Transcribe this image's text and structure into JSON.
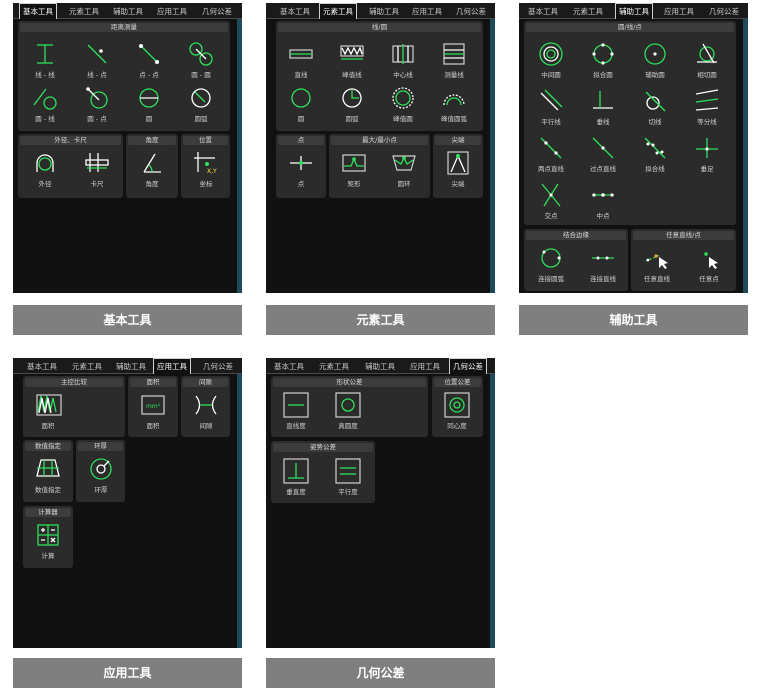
{
  "tabs": [
    "基本工具",
    "元素工具",
    "辅助工具",
    "应用工具",
    "几何公差"
  ],
  "captions": {
    "basic": "基本工具",
    "element": "元素工具",
    "aux": "辅助工具",
    "app": "应用工具",
    "geo": "几何公差"
  },
  "basic": {
    "dist_title": "距离测量",
    "dist_items": [
      "线 - 线",
      "线 - 点",
      "点 - 点",
      "圆 - 圆",
      "圆 - 线",
      "圆 - 点",
      "圆",
      "圆弧"
    ],
    "outer_title": "外径、卡尺",
    "outer_items": [
      "外径",
      "卡尺"
    ],
    "angle_title": "角度",
    "angle_item": "角度",
    "pos_title": "位置",
    "pos_item": "坐标",
    "xy_text": "X,Y"
  },
  "element": {
    "line_title": "线/圆",
    "line_items": [
      "直线",
      "峰值线",
      "中心线",
      "测量线",
      "圆",
      "圆弧",
      "峰值圆",
      "峰值圆弧"
    ],
    "point_title": "点",
    "point_item": "点",
    "maxmin_title": "最大/最小点",
    "maxmin_items": [
      "矩形",
      "圆环"
    ],
    "tip_title": "尖端",
    "tip_item": "尖端"
  },
  "aux": {
    "circ_title": "圆/线/点",
    "items": [
      "中间圆",
      "拟合圆",
      "辅助圆",
      "相切圆",
      "平行线",
      "垂线",
      "切线",
      "等分线",
      "两点直线",
      "过点直线",
      "拟合线",
      "垂足",
      "交点",
      "中点"
    ],
    "combo_title": "结合边缘",
    "combo_items": [
      "连接圆弧",
      "连接直线"
    ],
    "any_title": "任意直线/点",
    "any_items": [
      "任意直线",
      "任意点"
    ]
  },
  "app": {
    "main_title": "主控比较",
    "main_item": "面积",
    "area_title": "面积",
    "area_item": "面积",
    "area_icon_text": "mm²",
    "gap_title": "间隙",
    "gap_item": "间隙",
    "num_title": "数值指定",
    "num_item": "数值指定",
    "ring_title": "环厚",
    "ring_item": "环厚",
    "calc_title": "计算器",
    "calc_item": "计算"
  },
  "geo": {
    "shape_title": "形状公差",
    "shape_items": [
      "直线度",
      "真圆度"
    ],
    "pos_title": "位置公差",
    "pos_item": "同心度",
    "orient_title": "姿势公差",
    "orient_items": [
      "垂直度",
      "平行度"
    ]
  }
}
